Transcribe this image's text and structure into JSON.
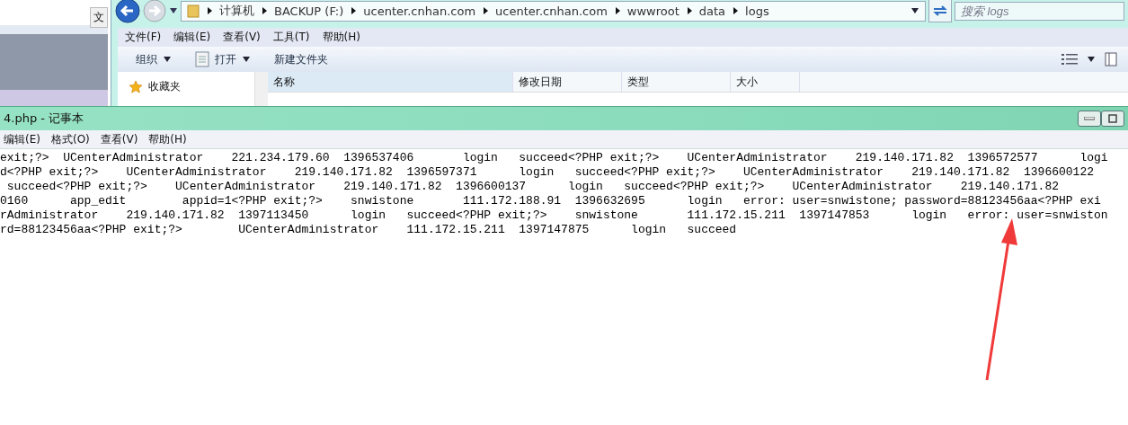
{
  "background_window": {
    "tab_label": "文"
  },
  "explorer": {
    "breadcrumb": [
      "计算机",
      "BACKUP (F:)",
      "ucenter.cnhan.com",
      "ucenter.cnhan.com",
      "wwwroot",
      "data",
      "logs"
    ],
    "search": {
      "placeholder": "搜索 logs"
    },
    "menu": [
      "文件(F)",
      "编辑(E)",
      "查看(V)",
      "工具(T)",
      "帮助(H)"
    ],
    "toolbar": [
      {
        "label": "组织",
        "kind": "dropdown"
      },
      {
        "label": "打开",
        "kind": "open"
      },
      {
        "label": "新建文件夹",
        "kind": "plain"
      }
    ],
    "nav": [
      {
        "label": "收藏夹"
      }
    ],
    "columns": [
      "名称",
      "修改日期",
      "类型",
      "大小"
    ]
  },
  "notepad": {
    "title": "4.php - 记事本",
    "menu": [
      "编辑(E)",
      "格式(O)",
      "查看(V)",
      "帮助(H)"
    ],
    "lines": [
      "exit;?>  UCenterAdministrator    221.234.179.60  1396537406       login   succeed<?PHP exit;?>    UCenterAdministrator    219.140.171.82  1396572577      logi",
      "d<?PHP exit;?>    UCenterAdministrator    219.140.171.82  1396597371      login   succeed<?PHP exit;?>    UCenterAdministrator    219.140.171.82  1396600122",
      " succeed<?PHP exit;?>    UCenterAdministrator    219.140.171.82  1396600137      login   succeed<?PHP exit;?>    UCenterAdministrator    219.140.171.82",
      "0160      app_edit        appid=1<?PHP exit;?>    snwistone       111.172.188.91  1396632695      login   error: user=snwistone; password=88123456aa<?PHP exi",
      "rAdministrator    219.140.171.82  1397113450      login   succeed<?PHP exit;?>    snwistone       111.172.15.211  1397147853      login   error: user=snwiston",
      "rd=88123456aa<?PHP exit;?>        UCenterAdministrator    111.172.15.211  1397147875      login   succeed"
    ]
  }
}
